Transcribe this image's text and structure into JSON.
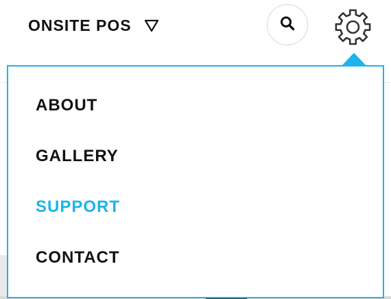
{
  "header": {
    "brand_label": "ONSITE POS",
    "brand_caret_icon": "triangle-down-outline-icon",
    "search_icon": "search-icon",
    "settings_icon": "gear-icon"
  },
  "menu": {
    "items": [
      {
        "label": "ABOUT",
        "active": false
      },
      {
        "label": "GALLERY",
        "active": false
      },
      {
        "label": "SUPPORT",
        "active": true
      },
      {
        "label": "CONTACT",
        "active": false
      }
    ]
  },
  "colors": {
    "accent": "#1cb4ea",
    "text": "#111111",
    "border": "#d8d8d8"
  }
}
